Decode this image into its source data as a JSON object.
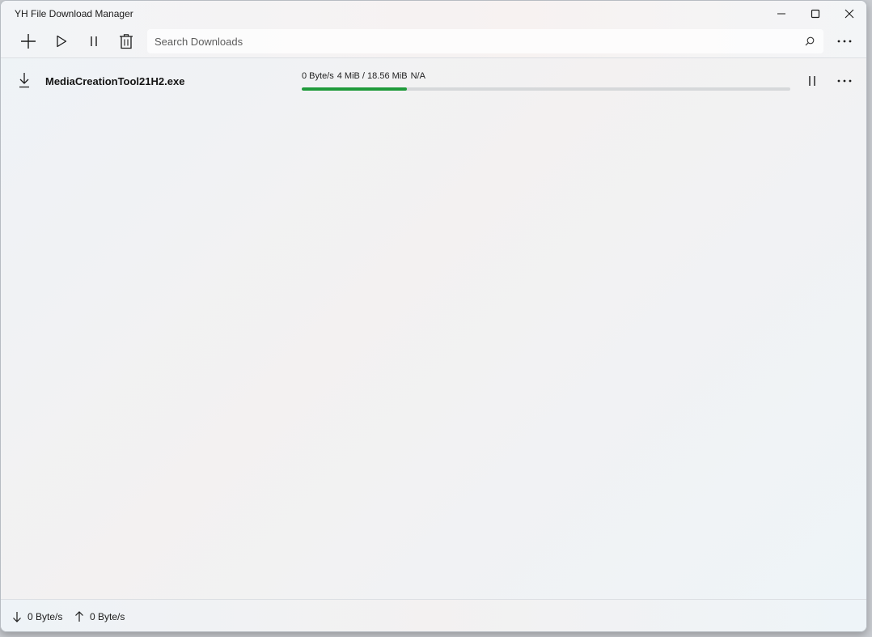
{
  "window": {
    "title": "YH File Download Manager"
  },
  "toolbar": {
    "add_icon": "plus-icon",
    "resume_icon": "play-icon",
    "pause_icon": "pause-icon",
    "delete_icon": "trash-icon",
    "search_placeholder": "Search Downloads",
    "search_value": "",
    "more_icon": "more-icon"
  },
  "downloads": [
    {
      "icon": "download-arrow-icon",
      "name": "MediaCreationTool21H2.exe",
      "speed": "0 Byte/s",
      "progress_text": "4 MiB / 18.56 MiB",
      "eta": "N/A",
      "progress_fraction": 0.2155,
      "progress_color": "#1f9a3a"
    }
  ],
  "statusbar": {
    "download_speed": "0 Byte/s",
    "upload_speed": "0 Byte/s"
  },
  "colors": {
    "accent": "#1f9a3a"
  }
}
